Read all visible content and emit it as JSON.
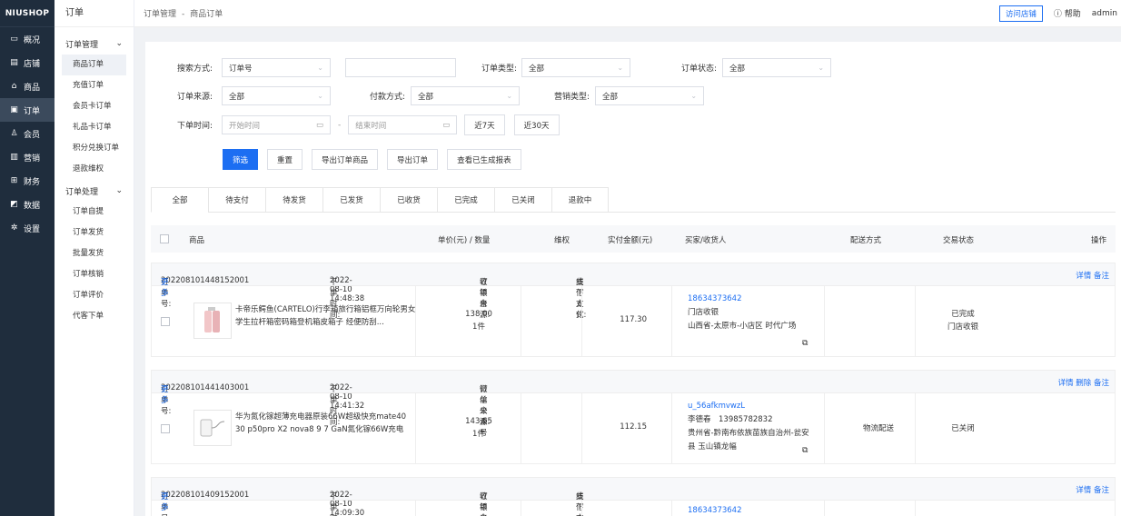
{
  "brand": "NIUSHOP",
  "sidebar": {
    "items": [
      {
        "label": "概况",
        "icon": "monitor-icon",
        "glyph": "▭"
      },
      {
        "label": "店铺",
        "icon": "shop-icon",
        "glyph": "▤"
      },
      {
        "label": "商品",
        "icon": "goods-icon",
        "glyph": "⌂"
      },
      {
        "label": "订单",
        "icon": "order-icon",
        "glyph": "▣"
      },
      {
        "label": "会员",
        "icon": "user-icon",
        "glyph": "♙"
      },
      {
        "label": "营销",
        "icon": "marketing-icon",
        "glyph": "▥"
      },
      {
        "label": "财务",
        "icon": "finance-icon",
        "glyph": "⊞"
      },
      {
        "label": "数据",
        "icon": "data-icon",
        "glyph": "◩"
      },
      {
        "label": "设置",
        "icon": "settings-icon",
        "glyph": "✲"
      }
    ]
  },
  "subnav": {
    "title": "订单",
    "group1": "订单管理",
    "group1_items": [
      "商品订单",
      "充值订单",
      "会员卡订单",
      "礼品卡订单",
      "积分兑换订单",
      "退款维权"
    ],
    "group2": "订单处理",
    "group2_items": [
      "订单自提",
      "订单发货",
      "批量发货",
      "订单核销",
      "订单评价",
      "代客下单"
    ]
  },
  "topbar": {
    "crumb1": "订单管理",
    "sep": "-",
    "crumb2": "商品订单",
    "visit": "访问店铺",
    "help": "帮助",
    "user": "admin"
  },
  "filters": {
    "search_mode_label": "搜索方式:",
    "search_mode_value": "订单号",
    "search_input_placeholder": "",
    "order_type_label": "订单类型:",
    "order_type_value": "全部",
    "order_status_label": "订单状态:",
    "order_status_value": "全部",
    "source_label": "订单来源:",
    "source_value": "全部",
    "pay_label": "付款方式:",
    "pay_value": "全部",
    "promo_label": "营销类型:",
    "promo_value": "全部",
    "time_label": "下单时间:",
    "start_ph": "开始时间",
    "dash": "-",
    "end_ph": "结束时间",
    "d7": "近7天",
    "d30": "近30天"
  },
  "actions": {
    "filter": "筛选",
    "reset": "重置",
    "export_goods": "导出订单商品",
    "export_order": "导出订单",
    "view_report": "查看已生成报表"
  },
  "tabs": [
    "全部",
    "待支付",
    "待发货",
    "已发货",
    "已收货",
    "已完成",
    "已关闭",
    "退款中"
  ],
  "table_head": {
    "goods": "商品",
    "price_qty": "单价(元) / 数量",
    "refund": "维权",
    "paid": "实付金额(元)",
    "buyer": "买家/收货人",
    "delivery": "配送方式",
    "status": "交易状态",
    "ops": "操作"
  },
  "orders": [
    {
      "no_label": "订单号:",
      "no": "202208101448152001",
      "more": "更多",
      "time_label": "下单时间:",
      "time": "2022-08-10 14:48:38",
      "source_label": "订单来源:",
      "source": "收银台",
      "pay_label": "支付方式:",
      "pay": "线下支付",
      "ops": "详情 备注",
      "product": "卡帝乐鳄鱼(CARTELO)行李箱旅行箱铝框万向轮男女学生拉杆箱密码箱登机箱皮箱子 经便防刮...",
      "price": "138.00",
      "qty": "1件",
      "paid": "117.30",
      "buyer": "18634373642",
      "receiver": "门店收银",
      "address": "山西省-太原市-小店区 时代广场",
      "delivery": "",
      "status": "已完成",
      "status2": "门店收银"
    },
    {
      "no_label": "订单号:",
      "no": "202208101441403001",
      "more": "更多",
      "time_label": "下单时间:",
      "time": "2022-08-10 14:41:32",
      "source_label": "订单来源:",
      "source": "微信公众号",
      "pay_label": "",
      "pay": "",
      "ops": "详情 删除 备注",
      "product": "华为氮化镓超薄充电器原装66W超级快充mate40 30 p50pro X2 nova8 9 7 GaN氮化镓66W充电",
      "price": "143.65",
      "qty": "1件",
      "paid": "112.15",
      "buyer": "u_56afkmvwzL",
      "receiver": "李德春　13985782832",
      "address": "贵州省-黔南布依族苗族自治州-瓮安县 玉山镇龙幅",
      "delivery": "物流配送",
      "status": "已关闭",
      "status2": ""
    },
    {
      "no_label": "订单号:",
      "no": "202208101409152001",
      "more": "更多",
      "time_label": "下单时间:",
      "time": "2022-08-10 14:09:30",
      "source_label": "订单来源:",
      "source": "收银台",
      "pay_label": "支付方式:",
      "pay": "线下支付",
      "ops": "详情 备注",
      "buyer": "18634373642"
    }
  ],
  "colors": {
    "accent": "#1c6ef2",
    "sidebar": "#1f2d3d"
  }
}
